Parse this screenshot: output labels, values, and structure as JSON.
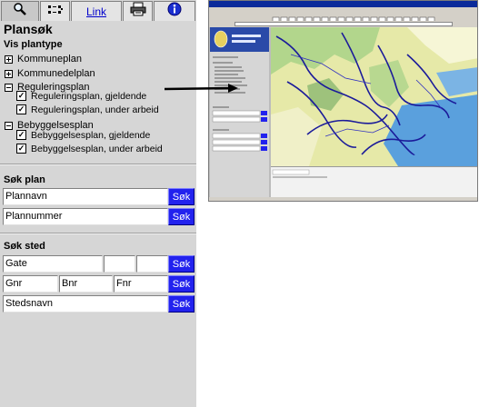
{
  "tabs": {
    "search_icon": "magnifier-icon",
    "layers_icon": "layers-icon",
    "link_label": "Link",
    "print_icon": "printer-icon",
    "info_icon": "info-icon"
  },
  "panel": {
    "title": "Plansøk",
    "subtitle": "Vis plantype",
    "tree": [
      {
        "label": "Kommuneplan",
        "expanded": false
      },
      {
        "label": "Kommunedelplan",
        "expanded": false
      },
      {
        "label": "Reguleringsplan",
        "expanded": true,
        "children": [
          {
            "label": "Reguleringsplan, gjeldende",
            "checked": true
          },
          {
            "label": "Reguleringsplan, under arbeid",
            "checked": true
          }
        ]
      },
      {
        "label": "Bebyggelsesplan",
        "expanded": true,
        "children": [
          {
            "label": "Bebyggelsesplan, gjeldende",
            "checked": true
          },
          {
            "label": "Bebyggelsesplan, under arbeid",
            "checked": true
          }
        ]
      }
    ]
  },
  "search_plan": {
    "title": "Søk plan",
    "plannavn_value": "Plannavn",
    "plannummer_value": "Plannummer",
    "button_label": "Søk"
  },
  "search_place": {
    "title": "Søk sted",
    "gate_value": "Gate",
    "gnr_value": "Gnr",
    "bnr_value": "Bnr",
    "fnr_value": "Fnr",
    "stedsnavn_value": "Stedsnavn",
    "button_label": "Søk"
  },
  "colors": {
    "panel_bg": "#d6d6d6",
    "button_bg": "#2222ee",
    "info_blue": "#1a2fd0",
    "link_blue": "#0000cc"
  }
}
